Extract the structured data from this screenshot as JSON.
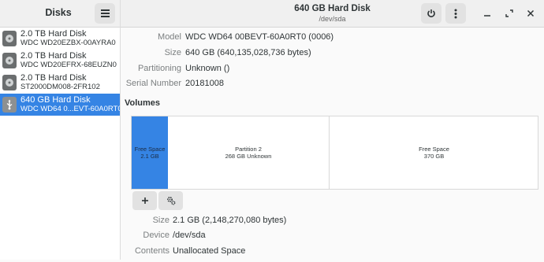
{
  "sidebar": {
    "title": "Disks",
    "disks": [
      {
        "name": "2.0 TB Hard Disk",
        "model": "WDC WD20EZBX-00AYRA0"
      },
      {
        "name": "2.0 TB Hard Disk",
        "model": "WDC WD20EFRX-68EUZN0"
      },
      {
        "name": "2.0 TB Hard Disk",
        "model": "ST2000DM008-2FR102"
      },
      {
        "name": "640 GB Hard Disk",
        "model": "WDC WD64 0...EVT-60A0RT0"
      }
    ]
  },
  "header": {
    "title": "640 GB Hard Disk",
    "subtitle": "/dev/sda"
  },
  "drive": [
    {
      "label": "Model",
      "value": "WDC WD64 00BEVT-60A0RT0 (0006)"
    },
    {
      "label": "Size",
      "value": "640 GB (640,135,028,736 bytes)"
    },
    {
      "label": "Partitioning",
      "value": "Unknown ()"
    },
    {
      "label": "Serial Number",
      "value": "20181008"
    }
  ],
  "volumes": {
    "title": "Volumes",
    "segments": [
      {
        "name": "Free Space",
        "detail": "2.1 GB"
      },
      {
        "name": "Partition 2",
        "detail": "268 GB Unknown"
      },
      {
        "name": "Free Space",
        "detail": "370 GB"
      }
    ],
    "selected_index": 0
  },
  "volume_details": [
    {
      "label": "Size",
      "value": "2.1 GB (2,148,270,080 bytes)"
    },
    {
      "label": "Device",
      "value": "/dev/sda"
    },
    {
      "label": "Contents",
      "value": "Unallocated Space"
    }
  ],
  "icons": {
    "menu": "hamburger-icon",
    "power": "power-icon",
    "more": "kebab-icon",
    "minimize": "minimize-icon",
    "maximize": "maximize-icon",
    "close": "close-icon",
    "add": "plus-icon",
    "settings": "gears-icon",
    "disk": "hard-disk-icon",
    "usb": "usb-icon"
  },
  "colors": {
    "accent": "#3584e4"
  }
}
